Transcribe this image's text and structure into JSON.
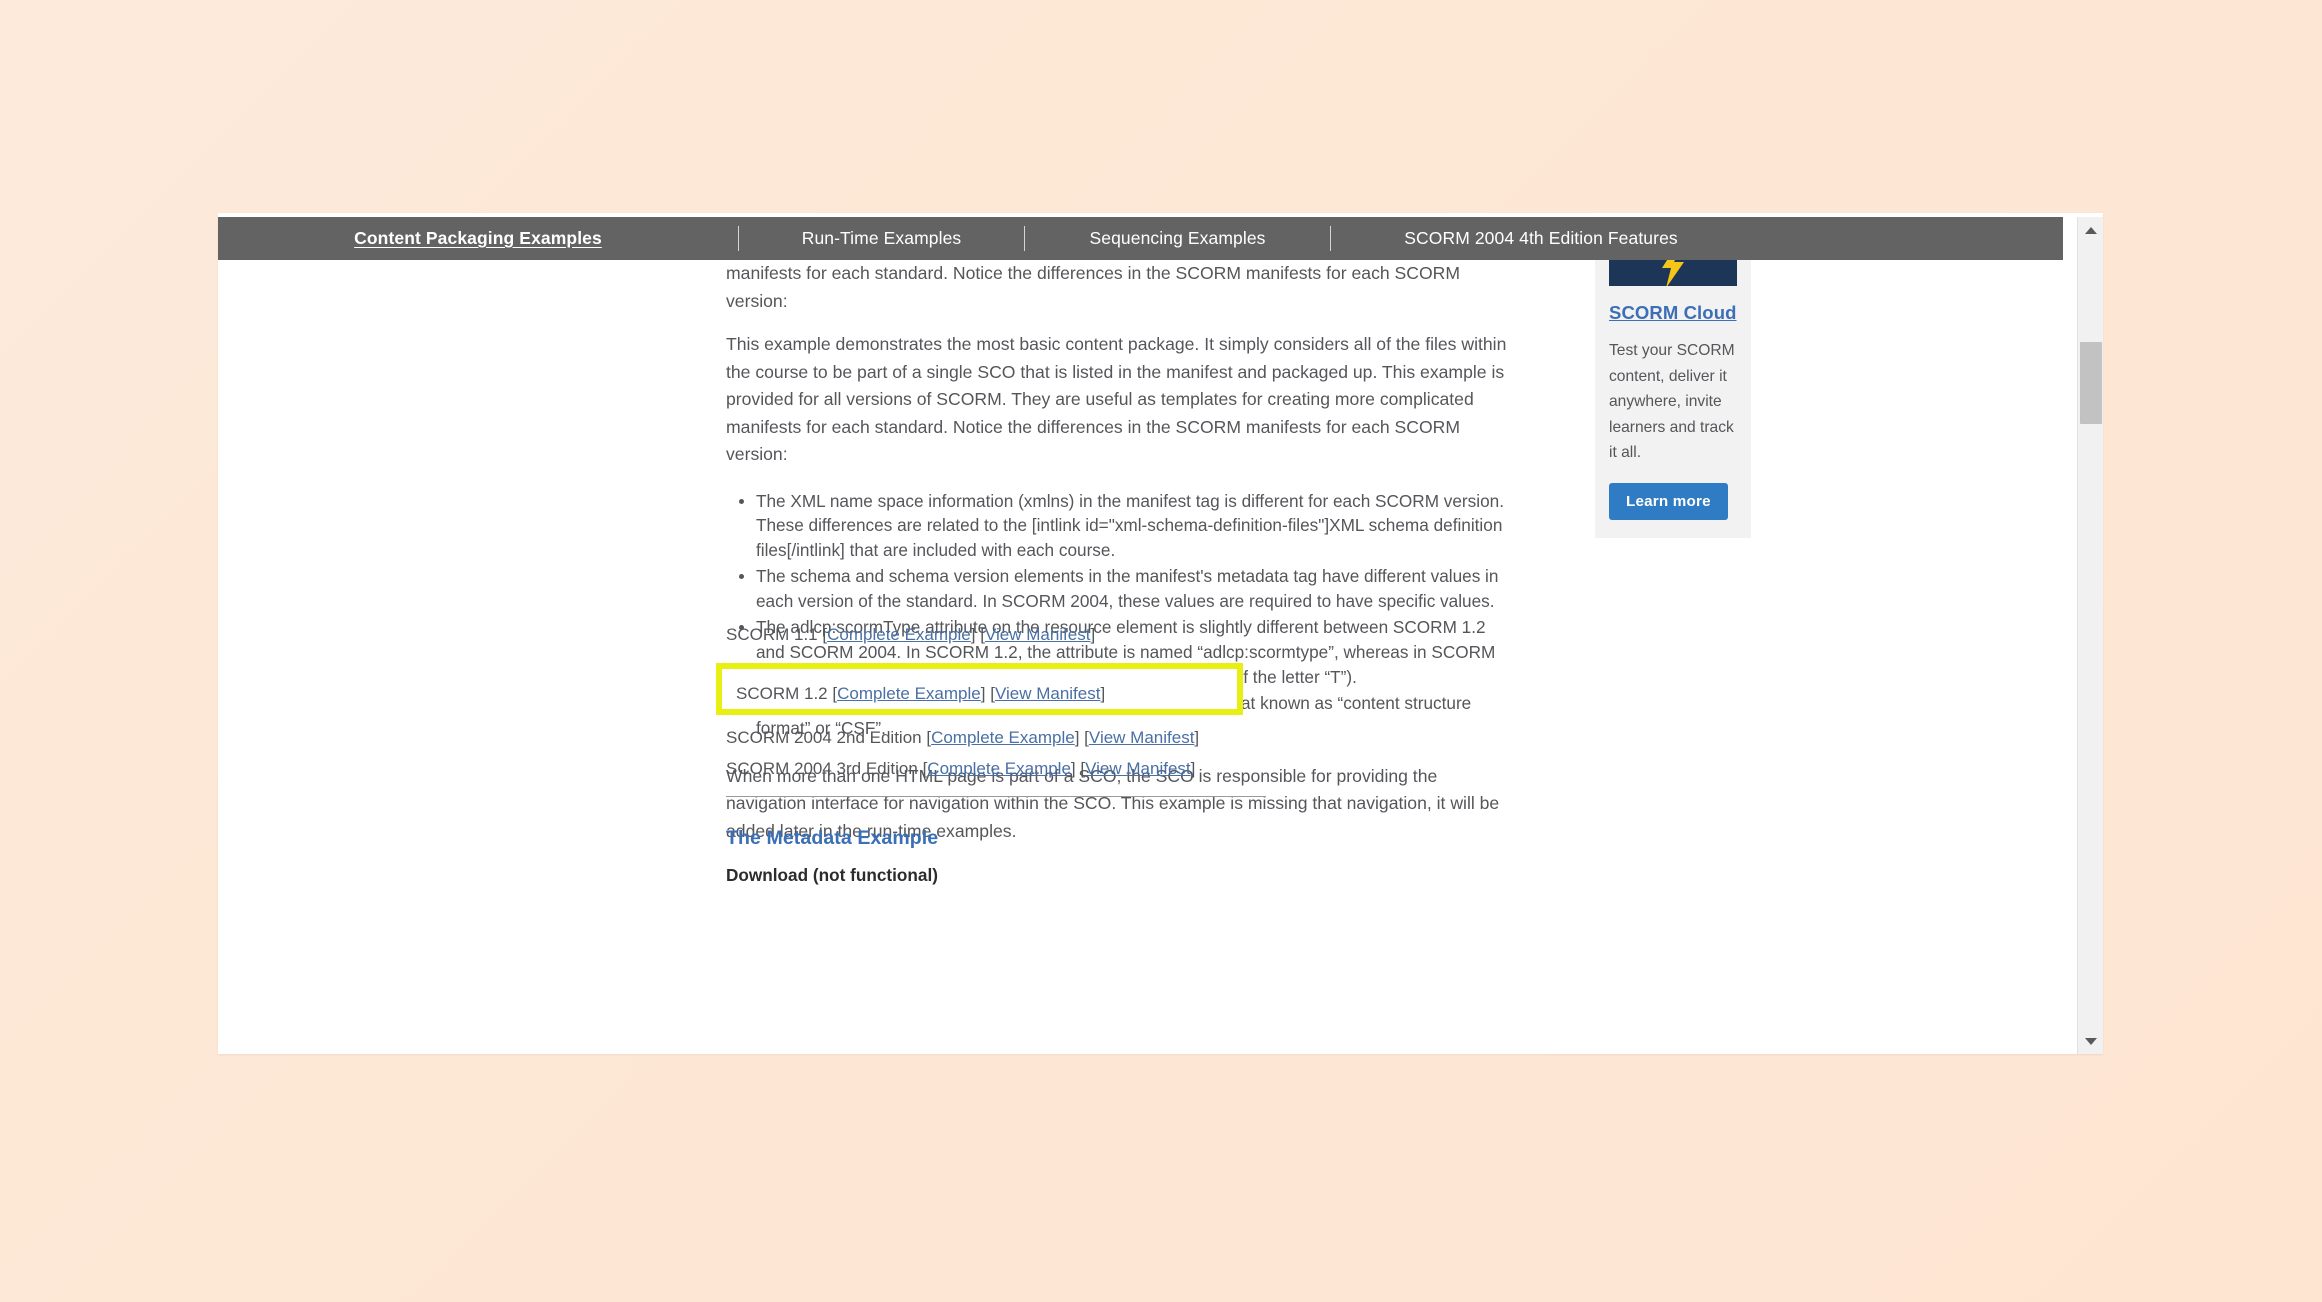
{
  "navbar": {
    "tabs": [
      {
        "label": "Content Packaging Examples",
        "active": true
      },
      {
        "label": "Run-Time Examples",
        "active": false
      },
      {
        "label": "Sequencing Examples",
        "active": false
      },
      {
        "label": "SCORM 2004 4th Edition Features",
        "active": false
      }
    ]
  },
  "article": {
    "clipped_paragraph": "manifests for each standard. Notice the differences in the SCORM manifests for each SCORM version:",
    "paragraph_1": "This example demonstrates the most basic content package. It simply considers all of the files within the course to be part of a single SCO that is listed in the manifest and packaged up. This example is provided for all versions of SCORM. They are useful as templates for creating more complicated manifests for each standard. Notice the differences in the SCORM manifests for each SCORM version:",
    "bullets": [
      "The XML name space information (xmlns) in the manifest tag is different for each SCORM version. These differences are related to the [intlink id=\"xml-schema-definition-files\"]XML schema definition files[/intlink] that are included with each course.",
      "The schema and schema version elements in the manifest's metadata tag have different values in each version of the standard. In SCORM 2004, these values are required to have specific values.",
      "The adlcp:scormType attribute on the resource element is slightly different between SCORM 1.2 and SCORM 2004. In SCORM 1.2, the attribute is named “adlcp:scormtype”, whereas in SCORM 2004, the attribute is named “adlcp:scormType” (note the case of the letter “T”).",
      "SCORM 1.1 uses a completely different content packaging format known as “content structure format” or “CSF”."
    ],
    "paragraph_2": "When more than one HTML page is part of a SCO, the SCO is responsible for providing the navigation interface for navigation within the SCO. This example is missing that navigation, it will be added later in the run-time examples.",
    "download_heading": "Download (not functional)",
    "downloads": [
      {
        "version": "SCORM 1.1",
        "complete_example": "Complete Example",
        "view_manifest": "View Manifest",
        "highlighted": false
      },
      {
        "version": "SCORM 1.2",
        "complete_example": "Complete Example",
        "view_manifest": "View Manifest",
        "highlighted": true
      },
      {
        "version": "SCORM 2004 2nd Edition",
        "complete_example": "Complete Example",
        "view_manifest": "View Manifest",
        "highlighted": false
      },
      {
        "version": "SCORM 2004 3rd Edition",
        "complete_example": "Complete Example",
        "view_manifest": "View Manifest",
        "highlighted": false
      }
    ],
    "bracket_open": "[",
    "bracket_close": "]",
    "next_section_heading": "The Metadata Example"
  },
  "sidebar": {
    "promo": {
      "title": "SCORM Cloud",
      "description": "Test your SCORM content, deliver it anywhere, invite learners and track it all.",
      "button_label": "Learn more"
    }
  },
  "colors": {
    "navbar_bg": "#636363",
    "highlight_border": "#e8f013",
    "link_blue": "#4a6fa5",
    "heading_blue": "#3b6fb6",
    "button_blue": "#2f7cc4",
    "banner_navy": "#1d3557",
    "bolt_yellow": "#f5c518",
    "page_bg": "#fde8d8"
  }
}
